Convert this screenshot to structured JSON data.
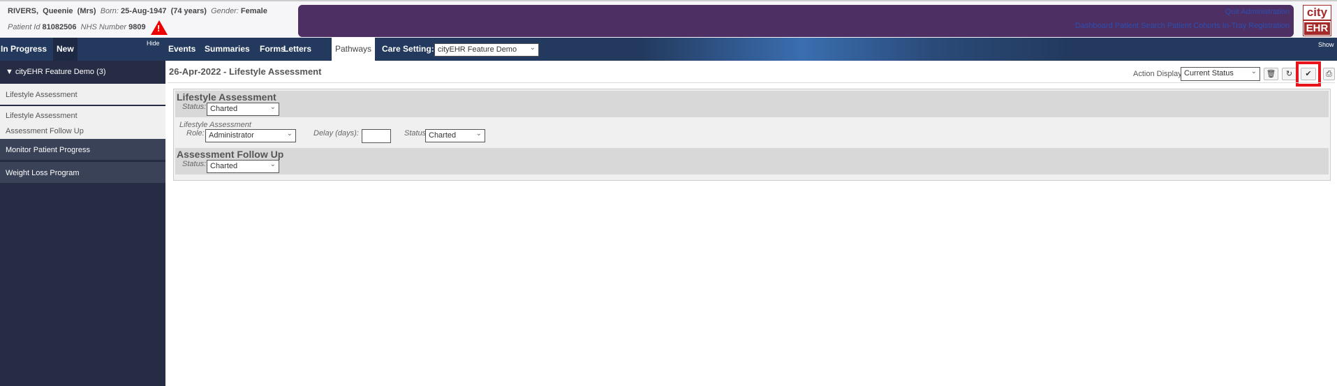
{
  "patient": {
    "surname": "RIVERS,",
    "forename": "Queenie",
    "title": "(Mrs)",
    "born_label": "Born:",
    "born": "25-Aug-1947",
    "age": "(74 years)",
    "gender_label": "Gender:",
    "gender": "Female",
    "id_label": "Patient Id",
    "id": "81082506",
    "nhs_label": "NHS Number",
    "nhs": "9809",
    "alert_glyph": "!"
  },
  "top_links": {
    "row1": [
      "Quit",
      "Administration"
    ],
    "row2": [
      "Dashboard",
      "Patient Search",
      "Patient Cohorts",
      "In-Tray",
      "Registration"
    ]
  },
  "logo": {
    "top": "city",
    "bottom": "EHR"
  },
  "nav": {
    "in_progress": "In Progress",
    "new": "New",
    "hide": "Hide",
    "show": "Show",
    "tabs": [
      "Events",
      "Summaries",
      "Forms",
      "Letters",
      "Pathways"
    ],
    "active_tab": "Pathways",
    "care_setting_label": "Care Setting:",
    "care_setting_value": "cityEHR Feature Demo"
  },
  "sidebar": {
    "group": "▼ cityEHR Feature Demo (3)",
    "items": [
      "Lifestyle Assessment",
      "Lifestyle Assessment",
      "Assessment Follow Up"
    ],
    "sections": [
      "Monitor Patient Progress",
      "Weight Loss Program"
    ]
  },
  "main": {
    "title": "26-Apr-2022 - Lifestyle Assessment",
    "action_display_label": "Action Display",
    "action_display_value": "Current Status",
    "sections": [
      {
        "title": "Lifestyle Assessment",
        "status_label": "Status:",
        "status": "Charted",
        "action": {
          "name": "Lifestyle Assessment",
          "role_label": "Role:",
          "role": "Administrator",
          "delay_label": "Delay (days):",
          "delay": "",
          "status_label": "Status:",
          "status": "Charted"
        }
      },
      {
        "title": "Assessment Follow Up",
        "status_label": "Status:",
        "status": "Charted"
      }
    ]
  },
  "colors": {
    "nav": "#233a5e",
    "sidebar": "#262c44",
    "purple": "#4e2f63",
    "logo": "#a52a2a",
    "highlight": "#e8141c"
  }
}
